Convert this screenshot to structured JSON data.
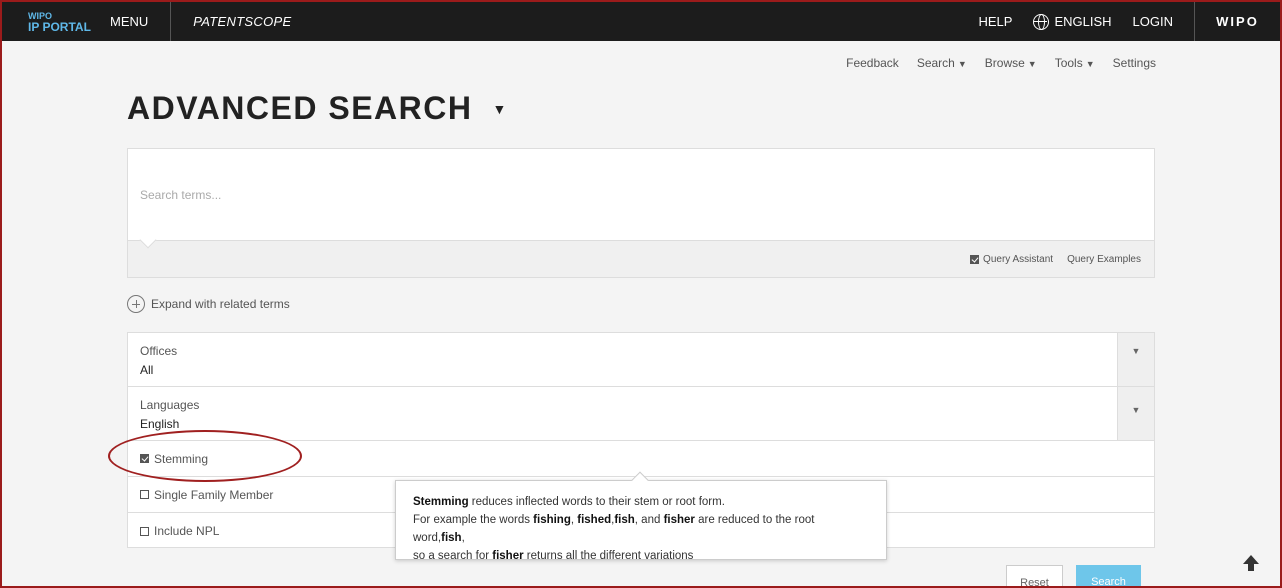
{
  "header": {
    "logo_top": "WIPO",
    "logo_bottom": "IP PORTAL",
    "menu_label": "MENU",
    "product": "PATENTSCOPE",
    "help": "HELP",
    "language": "ENGLISH",
    "login": "LOGIN",
    "brand": "WIPO"
  },
  "subnav": {
    "feedback": "Feedback",
    "search": "Search",
    "browse": "Browse",
    "tools": "Tools",
    "settings": "Settings",
    "caret": "▼"
  },
  "title": "ADVANCED SEARCH",
  "title_caret": "▼",
  "search": {
    "placeholder": "Search terms...",
    "query_assistant": "Query Assistant",
    "query_assistant_checked": true,
    "query_examples": "Query Examples"
  },
  "expand_label": "Expand with related terms",
  "options": {
    "offices": {
      "label": "Offices",
      "value": "All"
    },
    "languages": {
      "label": "Languages",
      "value": "English"
    },
    "select_caret": "▼",
    "stemming": {
      "label": "Stemming",
      "checked": true
    },
    "single_family": {
      "label": "Single Family Member",
      "checked": false
    },
    "include_npl": {
      "label": "Include NPL",
      "checked": false
    }
  },
  "tooltip": {
    "term": "Stemming",
    "line1_rest": " reduces inflected words to their stem or root form.",
    "line2_a": "For example the words ",
    "w1": "fishing",
    "sep1": ", ",
    "w2": "fished",
    "sep2": ",",
    "w3": "fish",
    "sep3": ", and ",
    "w4": "fisher",
    "line2_b": " are reduced to the root word,",
    "w5": "fish",
    "line2_c": ",",
    "line3_a": "so a search for ",
    "w6": "fisher",
    "line3_b": " returns all the different variations"
  },
  "buttons": {
    "reset": "Reset",
    "search": "Search"
  },
  "colors": {
    "topbar": "#1c1c1c",
    "accent": "#6ec6ea",
    "annotation": "#a02020"
  }
}
